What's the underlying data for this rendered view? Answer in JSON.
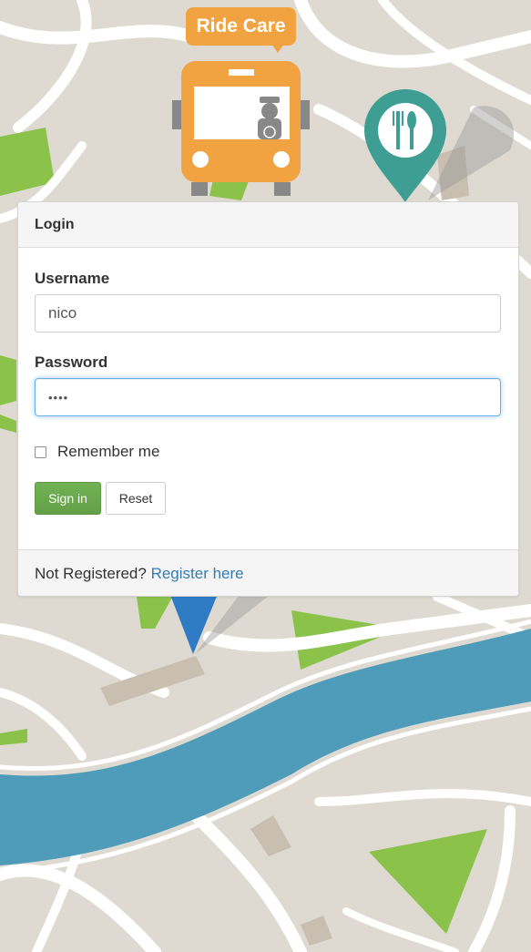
{
  "app": {
    "logo_text": "Ride Care"
  },
  "login": {
    "heading": "Login",
    "username_label": "Username",
    "username_value": "nico",
    "password_label": "Password",
    "password_value": "••••",
    "remember_label": "Remember me",
    "remember_checked": false,
    "signin_label": "Sign in",
    "reset_label": "Reset",
    "footer_text": "Not Registered?",
    "register_link": "Register here"
  },
  "colors": {
    "brand_orange": "#f0a340",
    "pin_teal": "#3f9e94",
    "pin_blue": "#2f7cc4",
    "river": "#4f9cba",
    "park_green": "#8bc34a",
    "signin_green": "#6aa84f",
    "link_blue": "#337ab7"
  },
  "icons": {
    "bus": "bus-icon",
    "restaurant_pin": "restaurant-pin-icon",
    "location_pin": "location-pin-icon"
  }
}
